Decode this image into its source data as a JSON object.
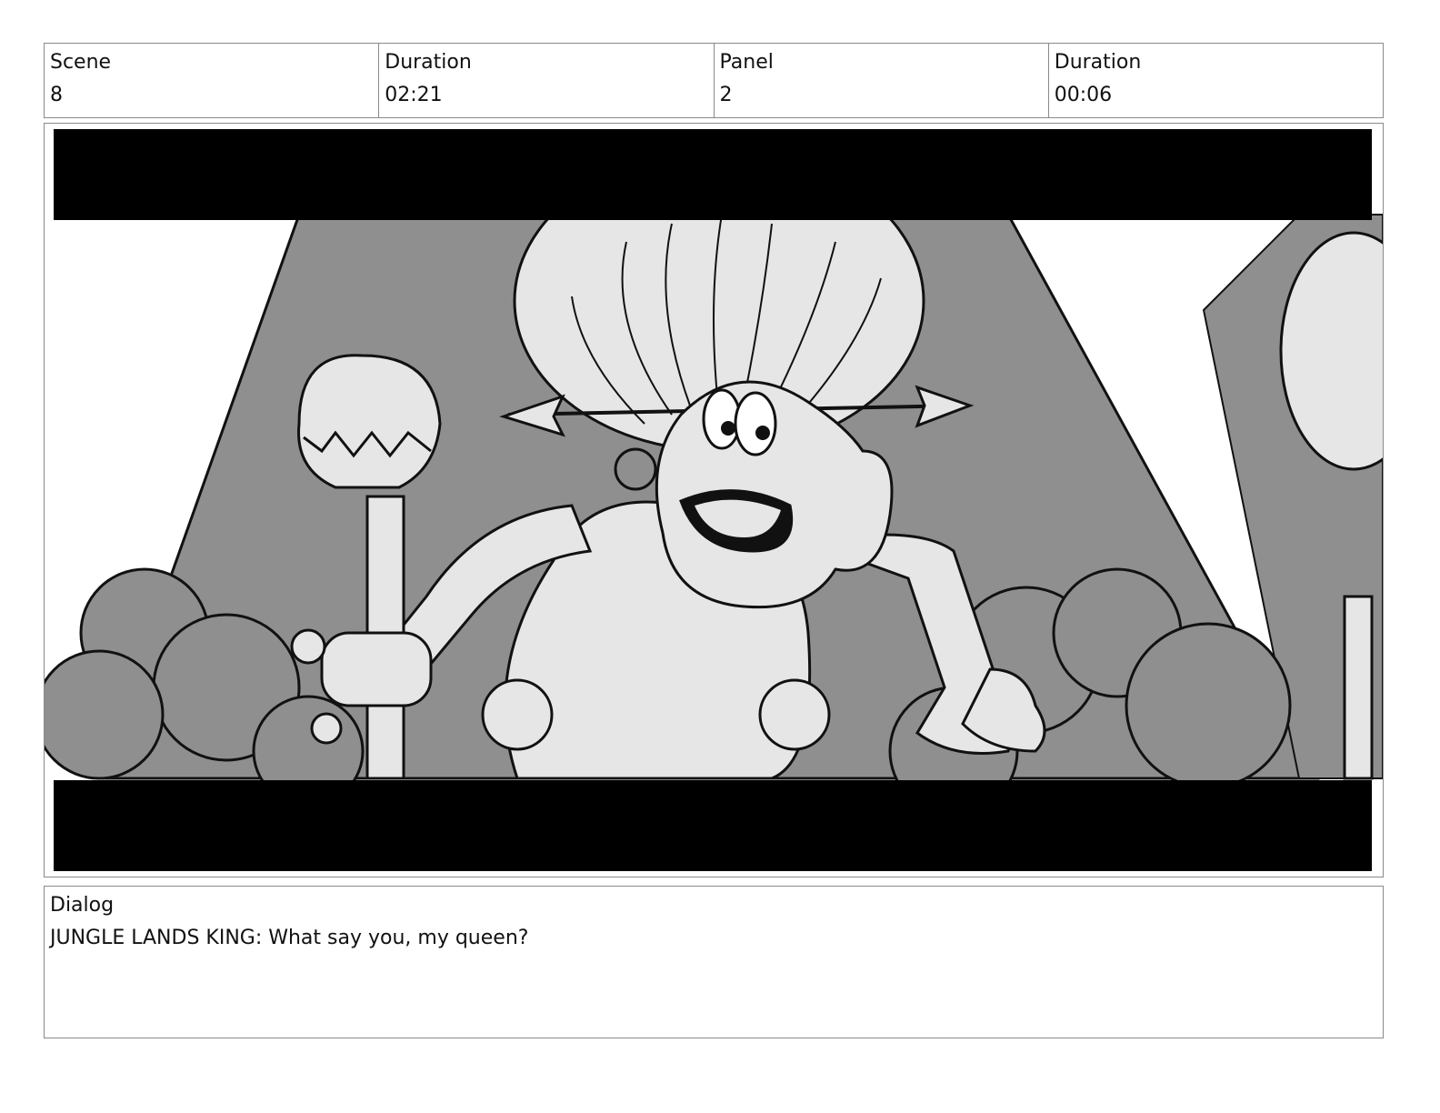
{
  "header": {
    "scene_label": "Scene",
    "scene_value": "8",
    "scene_duration_label": "Duration",
    "scene_duration_value": "02:21",
    "panel_label": "Panel",
    "panel_value": "2",
    "panel_duration_label": "Duration",
    "panel_duration_value": "00:06"
  },
  "dialog": {
    "label": "Dialog",
    "text": "JUNGLE LANDS KING: What say you, my queen?"
  },
  "colors": {
    "letterbox": "#000000",
    "background_gray": "#8f8f8f",
    "figure_light": "#e6e6e6",
    "line": "#111111"
  }
}
